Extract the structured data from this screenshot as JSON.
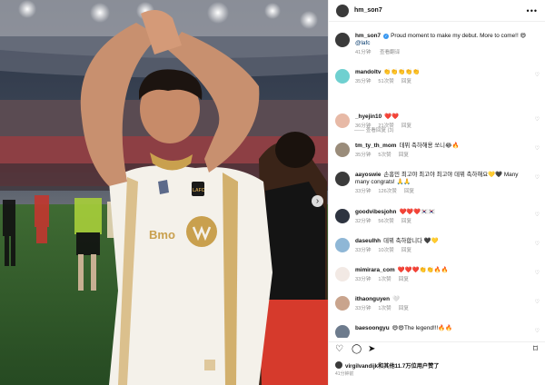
{
  "post": {
    "username": "hm_son7",
    "caption_text": "Proud moment to make my debut. More to come!! 😄",
    "caption_mention": "@lafc",
    "caption_time": "41分钟",
    "translate_label": "查看翻译"
  },
  "comments": [
    {
      "user": "mandoltv",
      "text": "👏👏👏👏👏",
      "time": "35分钟",
      "likes": "51次赞",
      "reply": "回复",
      "avatar_color": "#6fd0d0"
    },
    {
      "user": "_hyejin10",
      "text": "❤️❤️",
      "time": "36分钟",
      "likes": "21次赞",
      "reply": "回复",
      "avatar_color": "#e7b9a6"
    },
    {
      "user": "tm_ty_th_mom",
      "text": "데뷔 축하해용 쏘니😂🔥",
      "time": "35分钟",
      "likes": "5次赞",
      "reply": "回复",
      "avatar_color": "#9a8c7a"
    },
    {
      "user": "aayoswie",
      "text": "손흥민 최고야 최고야 최고야 데뷔 축하해요💛🖤 Many many congrats! 🙏🙏",
      "time": "33分钟",
      "likes": "126次赞",
      "reply": "回复",
      "avatar_color": "#3b3b3b"
    },
    {
      "user": "goodvibesjohn",
      "text": "❤️❤️❤️🇰🇷🇰🇷",
      "time": "32分钟",
      "likes": "56次赞",
      "reply": "回复",
      "avatar_color": "#2e3440"
    },
    {
      "user": "daseulhh",
      "text": "데뷔 축하합니다 🖤💛",
      "time": "33分钟",
      "likes": "10次赞",
      "reply": "回复",
      "avatar_color": "#8fb7d6"
    },
    {
      "user": "mimirara_com",
      "text": "❤️❤️❤️👏👏🔥🔥",
      "time": "33分钟",
      "likes": "1次赞",
      "reply": "回复",
      "avatar_color": "#f2e9e4"
    },
    {
      "user": "ithaonguyen",
      "text": "🤍",
      "time": "33分钟",
      "likes": "1次赞",
      "reply": "回复",
      "avatar_color": "#c9a48d"
    },
    {
      "user": "baesoongyu",
      "text": "😄😄The legend!!!🔥🔥",
      "time": "",
      "likes": "",
      "reply": "",
      "avatar_color": "#6d7b8d"
    }
  ],
  "view_replies": "查看回复 (3)",
  "likes_summary": "virgilvandijk和其他11.7万位用户赞了",
  "post_time": "41分钟前",
  "icons": {
    "more": "more-icon",
    "heart": "heart-icon",
    "comment": "comment-icon",
    "share": "share-icon",
    "bookmark": "bookmark-icon",
    "next": "chevron-right-icon"
  },
  "colors": {
    "link": "#00376b",
    "verified": "#3897f0",
    "accent_gold": "#c9a04e"
  },
  "jersey": {
    "badge_text": "LAFC",
    "sponsor_text": "Bmo"
  }
}
